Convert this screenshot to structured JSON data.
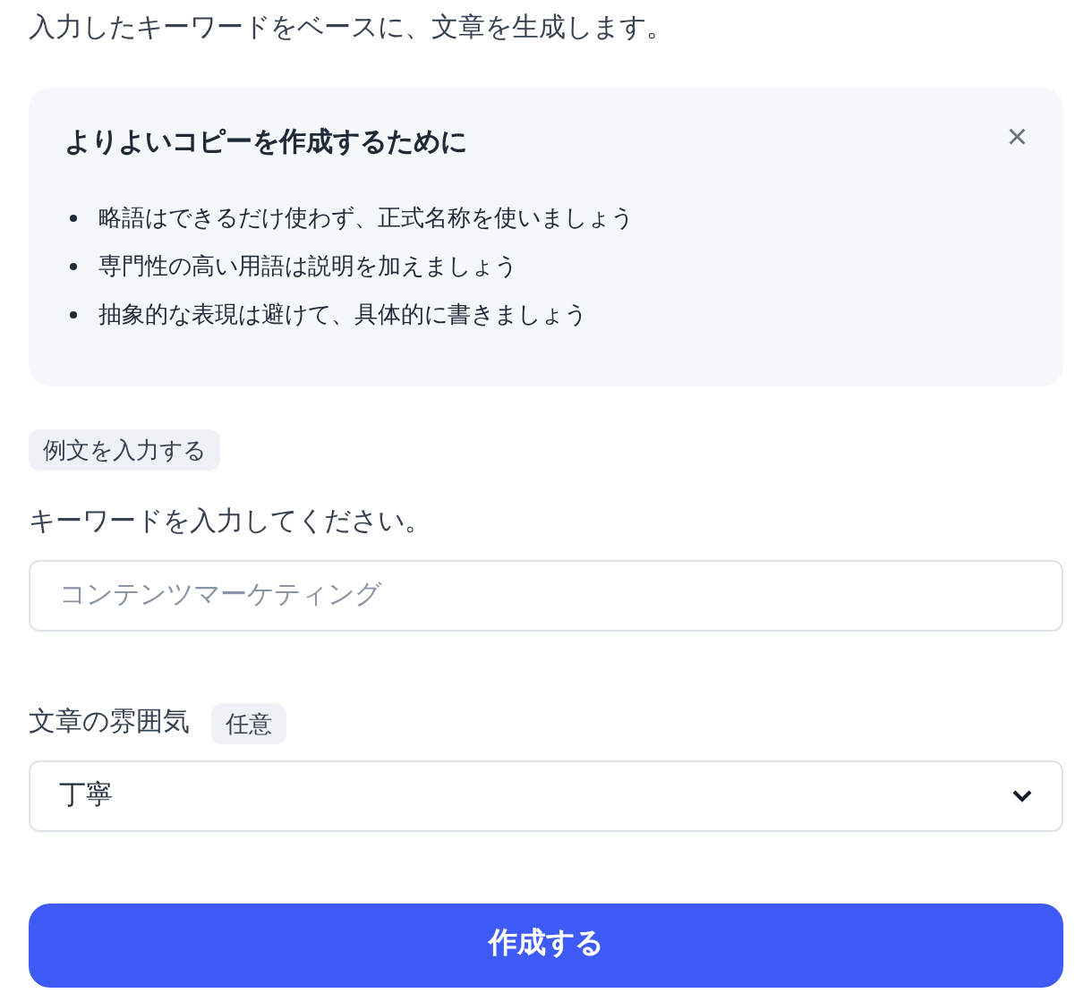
{
  "intro": "入力したキーワードをベースに、文章を生成します。",
  "tips": {
    "title": "よりよいコピーを作成するために",
    "close": "×",
    "items": [
      "略語はできるだけ使わず、正式名称を使いましょう",
      "専門性の高い用語は説明を加えましょう",
      "抽象的な表現は避けて、具体的に書きましょう"
    ]
  },
  "example_button": "例文を入力する",
  "keyword": {
    "label": "キーワードを入力してください。",
    "placeholder": "コンテンツマーケティング"
  },
  "tone": {
    "label": "文章の雰囲気",
    "badge": "任意",
    "value": "丁寧"
  },
  "submit": "作成する"
}
